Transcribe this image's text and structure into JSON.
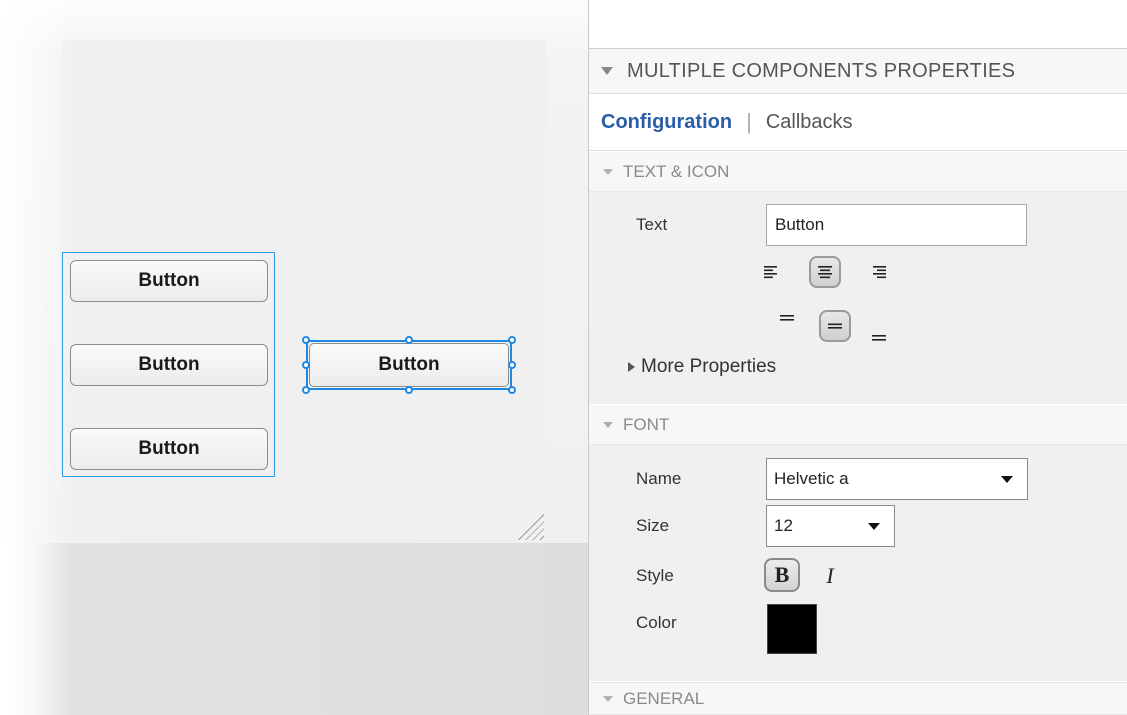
{
  "canvas": {
    "group_buttons": [
      "Button",
      "Button",
      "Button"
    ],
    "selected_button": "Button"
  },
  "inspector": {
    "title": "MULTIPLE COMPONENTS PROPERTIES",
    "tabs": [
      {
        "label": "Configuration",
        "active": true
      },
      {
        "label": "Callbacks",
        "active": false
      }
    ],
    "sections": {
      "text_icon": {
        "header": "TEXT & ICON",
        "text_label": "Text",
        "text_value": "Button",
        "horizontal_alignment": [
          "left",
          "center",
          "right"
        ],
        "horizontal_selected": "center",
        "vertical_alignment": [
          "top",
          "middle",
          "bottom"
        ],
        "vertical_selected": "middle",
        "more_properties": "More Properties"
      },
      "font": {
        "header": "FONT",
        "name_label": "Name",
        "name_value": "Helvetic a",
        "size_label": "Size",
        "size_value": "12",
        "style_label": "Style",
        "bold_glyph": "B",
        "bold_active": true,
        "italic_glyph": "I",
        "italic_active": false,
        "color_label": "Color",
        "color_value": "#000000"
      },
      "general": {
        "header": "GENERAL"
      }
    }
  },
  "colors": {
    "selection": "#1e88e5",
    "tab_active": "#2b5ea8"
  }
}
